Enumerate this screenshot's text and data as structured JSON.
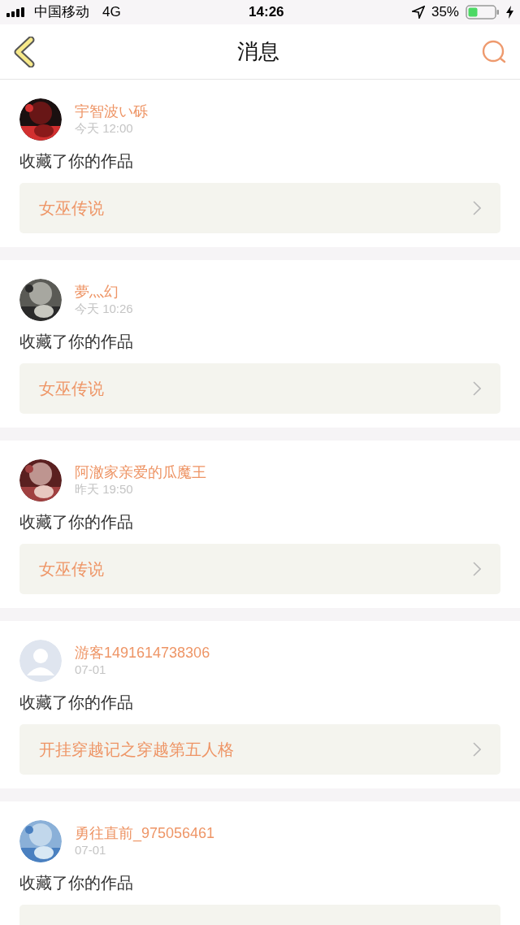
{
  "status_bar": {
    "carrier": "中国移动",
    "network": "4G",
    "time": "14:26",
    "battery_text": "35%"
  },
  "header": {
    "title": "消息"
  },
  "messages": [
    {
      "user": "宇智波い砾",
      "time": "今天 12:00",
      "action": "收藏了你的作品",
      "work": "女巫传说"
    },
    {
      "user": "夢灬幻",
      "time": "今天 10:26",
      "action": "收藏了你的作品",
      "work": "女巫传说"
    },
    {
      "user": "阿澈家亲爱的瓜魔王",
      "time": "昨天 19:50",
      "action": "收藏了你的作品",
      "work": "女巫传说"
    },
    {
      "user": "游客1491614738306",
      "time": "07-01",
      "avatar": {
        "kind": "default"
      },
      "action": "收藏了你的作品",
      "work": "开挂穿越记之穿越第五人格"
    },
    {
      "user": "勇往直前_975056461",
      "time": "07-01",
      "action": "收藏了你的作品"
    }
  ]
}
